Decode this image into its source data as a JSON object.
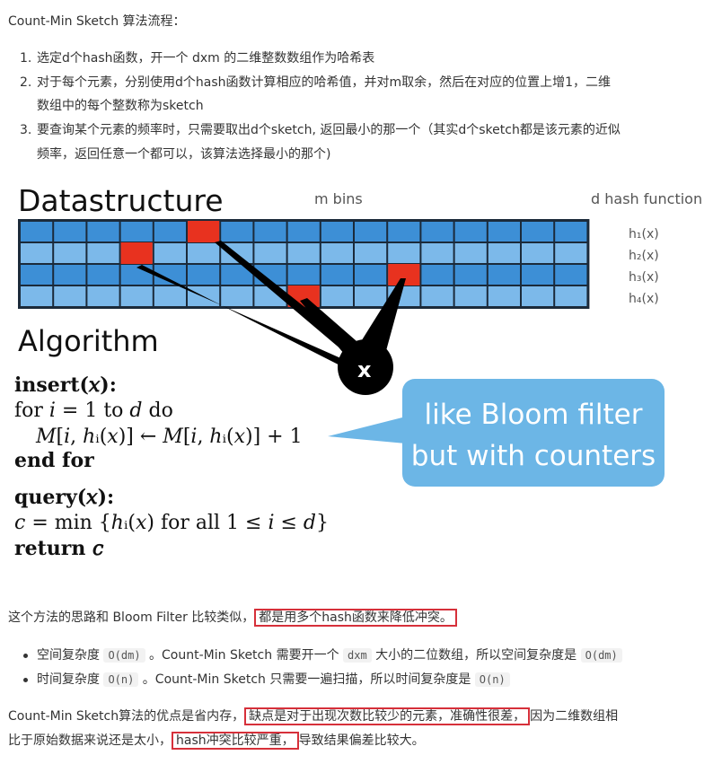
{
  "intro": {
    "heading": "Count-Min Sketch 算法流程：",
    "steps": [
      {
        "num": "1.",
        "lines": [
          "选定d个hash函数，开一个 dxm 的二维整数数组作为哈希表"
        ]
      },
      {
        "num": "2.",
        "lines": [
          "对于每个元素，分别使用d个hash函数计算相应的哈希值，并对m取余，然后在对应的位置上增1，二维",
          "数组中的每个整数称为sketch"
        ]
      },
      {
        "num": "3.",
        "lines": [
          "要查询某个元素的频率时，只需要取出d个sketch, 返回最小的那一个（其实d个sketch都是该元素的近似",
          "频率，返回任意一个都可以，该算法选择最小的那个)"
        ]
      }
    ]
  },
  "figure": {
    "title_datastructure": "Datastructure",
    "label_m_bins": "m bins",
    "label_d_hash": "d hash functions",
    "hash_labels": [
      "h₁(x)",
      "h₂(x)",
      "h₃(x)",
      "h₄(x)"
    ],
    "title_algorithm": "Algorithm",
    "x_label": "x",
    "bubble_line1": "like Bloom filter",
    "bubble_line2": "but with counters",
    "insert_line": "insert(𝑥):",
    "for_line": "for 𝑖 = 1 to 𝑑 do",
    "update_line": "𝑀[𝑖, ℎᵢ(𝑥)] ← 𝑀[𝑖, ℎᵢ(𝑥)] + 1",
    "endfor_line": "end for",
    "query_line": "query(𝑥):",
    "min_line": "𝑐 = min {ℎᵢ(𝑥) for all 1 ≤ 𝑖 ≤ 𝑑}",
    "return_line": "return 𝑐",
    "colors": {
      "cell_dark": "#3d8fd6",
      "cell_light": "#7cb9ea",
      "hit": "#e8321f",
      "bubble": "#6cb6e6"
    }
  },
  "para1": {
    "pre": "这个方法的思路和 Bloom Filter 比较类似，",
    "highlight": "都是用多个hash函数来降低冲突。"
  },
  "bullets": [
    {
      "a": "空间复杂度 ",
      "code1": "O(dm)",
      "b": " 。Count-Min Sketch 需要开一个 ",
      "code2": "dxm",
      "c": " 大小的二位数组，所以空间复杂度是 ",
      "code3": "O(dm)"
    },
    {
      "a": "时间复杂度 ",
      "code1": "O(n)",
      "b": " 。Count-Min Sketch 只需要一遍扫描，所以时间复杂度是 ",
      "code2": "O(n)"
    }
  ],
  "para2": {
    "l1_pre": "Count-Min Sketch算法的优点是省内存，",
    "l1_hl": "缺点是对于出现次数比较少的元素，准确性很差，",
    "l1_post": "因为二维数组相",
    "l2_pre": "比于原始数据来说还是太小，",
    "l2_hl": "hash冲突比较严重，",
    "l2_post": "导致结果偏差比较大。"
  }
}
